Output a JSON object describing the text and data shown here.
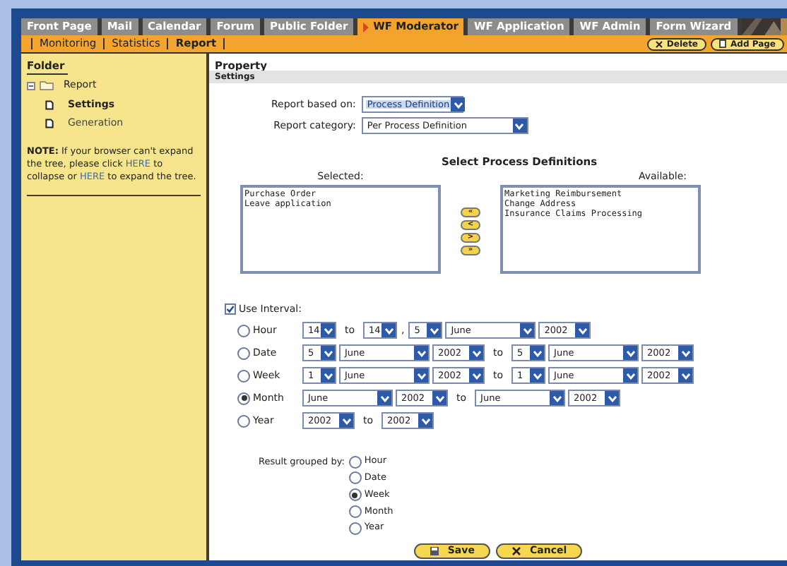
{
  "tabs": [
    {
      "label": "Front Page",
      "selected": false
    },
    {
      "label": "Mail",
      "selected": false
    },
    {
      "label": "Calendar",
      "selected": false
    },
    {
      "label": "Forum",
      "selected": false
    },
    {
      "label": "Public Folder",
      "selected": false
    },
    {
      "label": "WF Moderator",
      "selected": true
    },
    {
      "label": "WF Application",
      "selected": false
    },
    {
      "label": "WF Admin",
      "selected": false
    },
    {
      "label": "Form Wizard",
      "selected": false
    }
  ],
  "subnav": [
    {
      "label": "Monitoring",
      "selected": false
    },
    {
      "label": "Statistics",
      "selected": false
    },
    {
      "label": "Report",
      "selected": true
    }
  ],
  "toolbar_buttons": [
    {
      "label": "Delete",
      "kind": "delete"
    },
    {
      "label": "Add Page",
      "kind": "page"
    }
  ],
  "sidebar": {
    "title": "Folder",
    "tree": [
      {
        "label": "Report",
        "expanded": true,
        "children": [
          {
            "label": "Settings",
            "selected": true
          },
          {
            "label": "Generation",
            "selected": false
          }
        ]
      }
    ],
    "note_label": "NOTE:",
    "note_parts": [
      " If your browser can't expand the tree, please click ",
      "HERE",
      " to collapse or ",
      "HERE",
      " to expand the tree."
    ]
  },
  "main": {
    "title": "Property",
    "section": "Settings",
    "report_based_on": {
      "label": "Report based on:",
      "value": "Process Definition"
    },
    "report_category": {
      "label": "Report category:",
      "value": "Per Process Definition"
    },
    "definitions": {
      "title": "Select Process Definitions",
      "selected_label": "Selected:",
      "available_label": "Available:",
      "selected_items": [
        "Purchase Order",
        "Leave application"
      ],
      "available_items": [
        "Marketing Reimbursement",
        "Change Address",
        "Insurance Claims Processing"
      ],
      "move_buttons": [
        "«",
        "<",
        ">",
        "»"
      ]
    },
    "use_interval": {
      "label": "Use Interval:",
      "checked": true
    },
    "interval_rows": [
      {
        "label": "Hour",
        "selected": false,
        "parts": [
          {
            "kind": "day",
            "value": "14"
          },
          {
            "kind": "text",
            "value": "to"
          },
          {
            "kind": "day",
            "value": "14"
          },
          {
            "kind": "text",
            "value": ","
          },
          {
            "kind": "day",
            "value": "5"
          },
          {
            "kind": "month",
            "value": "June"
          },
          {
            "kind": "year",
            "value": "2002"
          }
        ]
      },
      {
        "label": "Date",
        "selected": false,
        "parts": [
          {
            "kind": "day",
            "value": "5"
          },
          {
            "kind": "month",
            "value": "June"
          },
          {
            "kind": "year",
            "value": "2002"
          },
          {
            "kind": "text",
            "value": "to"
          },
          {
            "kind": "day",
            "value": "5"
          },
          {
            "kind": "month",
            "value": "June"
          },
          {
            "kind": "year",
            "value": "2002"
          }
        ]
      },
      {
        "label": "Week",
        "selected": false,
        "parts": [
          {
            "kind": "day",
            "value": "1"
          },
          {
            "kind": "month",
            "value": "June"
          },
          {
            "kind": "year",
            "value": "2002"
          },
          {
            "kind": "text",
            "value": "to"
          },
          {
            "kind": "day",
            "value": "1"
          },
          {
            "kind": "month",
            "value": "June"
          },
          {
            "kind": "year",
            "value": "2002"
          }
        ]
      },
      {
        "label": "Month",
        "selected": true,
        "parts": [
          {
            "kind": "month",
            "value": "June"
          },
          {
            "kind": "year",
            "value": "2002"
          },
          {
            "kind": "text",
            "value": "to"
          },
          {
            "kind": "month",
            "value": "June"
          },
          {
            "kind": "year",
            "value": "2002"
          }
        ]
      },
      {
        "label": "Year",
        "selected": false,
        "parts": [
          {
            "kind": "year",
            "value": "2002"
          },
          {
            "kind": "text",
            "value": "to"
          },
          {
            "kind": "year",
            "value": "2002"
          }
        ]
      }
    ],
    "group_by": {
      "label": "Result grouped by:",
      "options": [
        {
          "label": "Hour",
          "selected": false
        },
        {
          "label": "Date",
          "selected": false
        },
        {
          "label": "Week",
          "selected": true
        },
        {
          "label": "Month",
          "selected": false
        },
        {
          "label": "Year",
          "selected": false
        }
      ]
    },
    "actions": [
      {
        "label": "Save",
        "kind": "save"
      },
      {
        "label": "Cancel",
        "kind": "cancel"
      }
    ]
  }
}
